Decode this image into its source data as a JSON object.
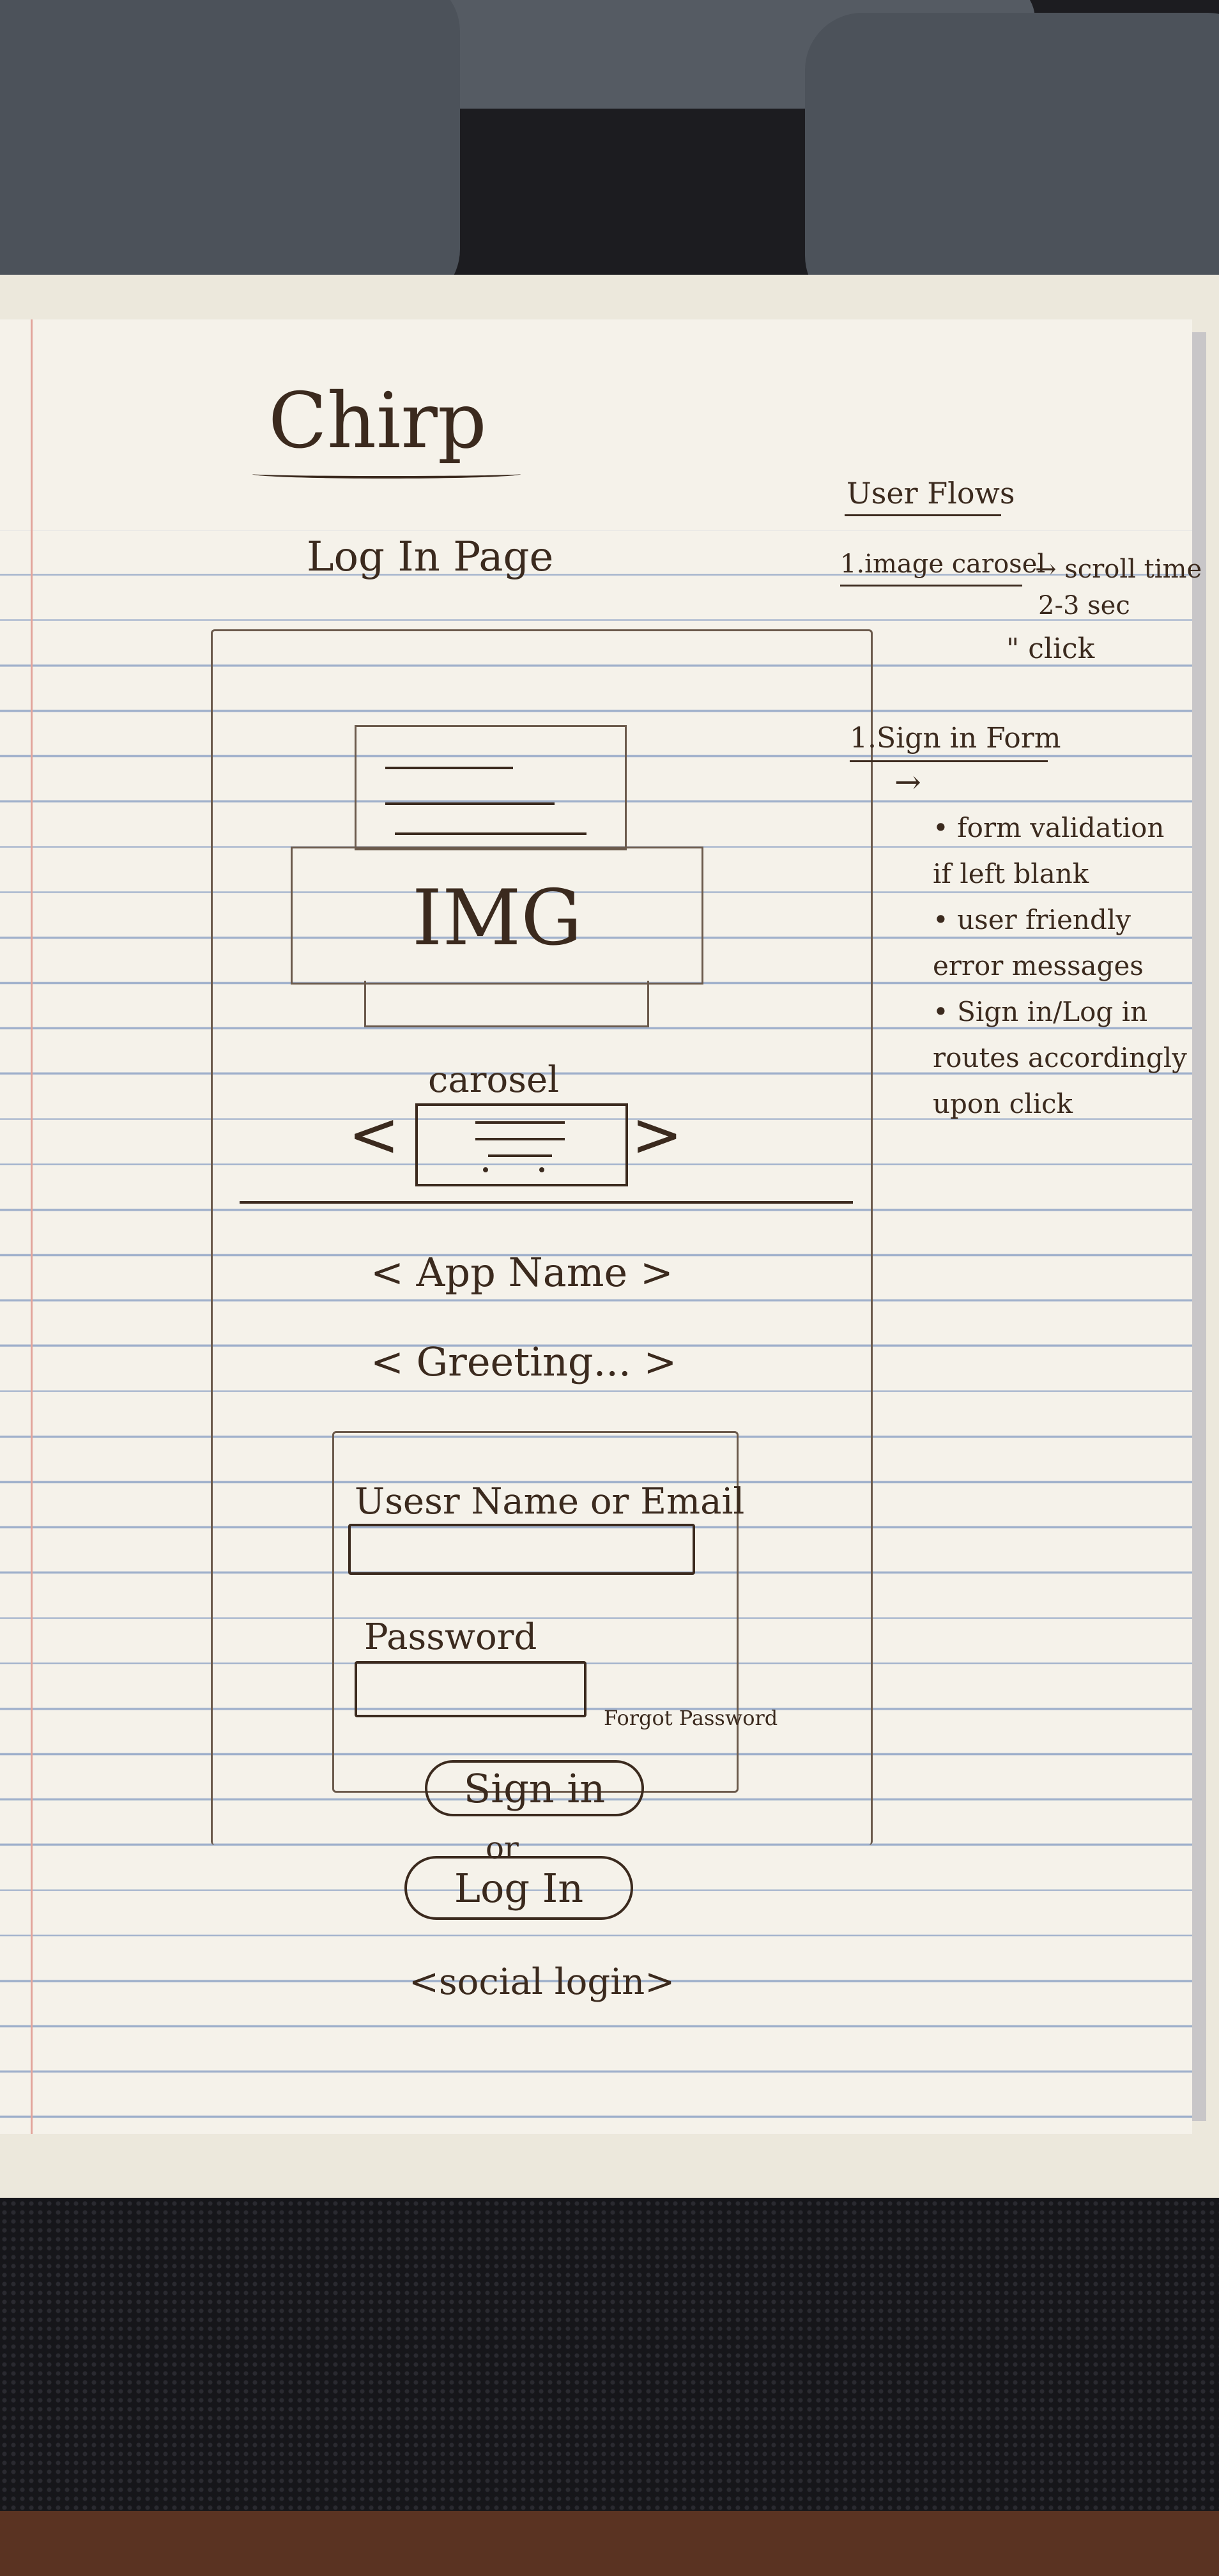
{
  "title": "Chirp",
  "subtitle": "Log In Page",
  "wireframe": {
    "img_label": "IMG",
    "carousel_label": "carosel",
    "carousel_prev": "<",
    "carousel_next": ">",
    "app_name": "< App Name >",
    "greeting": "< Greeting... >",
    "username_label": "Usesr Name or Email",
    "password_label": "Password",
    "forgot_password": "Forgot Password",
    "signin_button": "Sign in",
    "or_text": "or",
    "login_button": "Log In",
    "social_login": "<social login>"
  },
  "user_flows": {
    "heading": "User Flows",
    "item1": "1.image carosel",
    "item1_note": "→ scroll time",
    "item1_time": "2-3 sec",
    "item1_click": "\" click",
    "item2": "1.Sign in Form",
    "item2_arrow": "→",
    "bullets": [
      "• form validation",
      "if left blank",
      "• user friendly",
      "error messages",
      "• Sign in/Log in",
      "routes accordingly",
      "upon click"
    ]
  }
}
